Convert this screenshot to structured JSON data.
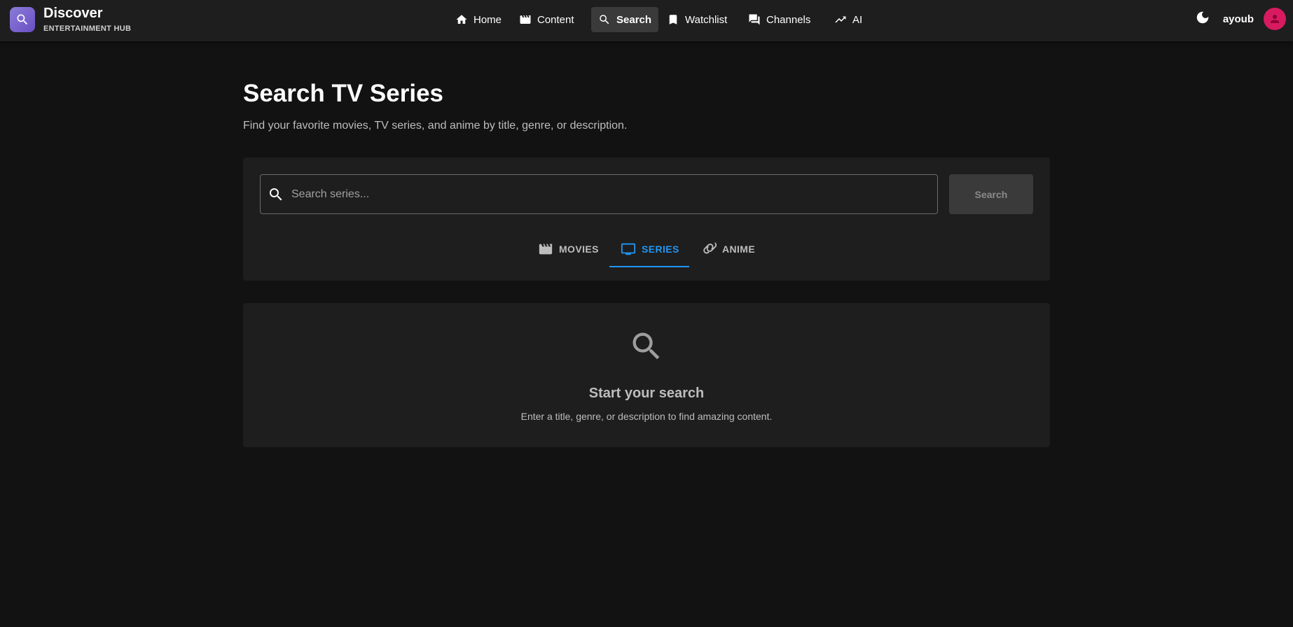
{
  "brand": {
    "title": "Discover",
    "subtitle": "ENTERTAINMENT HUB",
    "logo_icon": "search-icon",
    "logo_color": "#7e67d0"
  },
  "nav": {
    "items": [
      {
        "label": "Home",
        "icon": "home-icon",
        "active": false
      },
      {
        "label": "Content",
        "icon": "movie-icon",
        "active": false
      },
      {
        "label": "Search",
        "icon": "search-icon",
        "active": true
      },
      {
        "label": "Watchlist",
        "icon": "bookmark-icon",
        "active": false
      },
      {
        "label": "Channels",
        "icon": "forum-icon",
        "active": false
      },
      {
        "label": "AI",
        "icon": "trending-up-icon",
        "active": false
      }
    ]
  },
  "user": {
    "name": "ayoub",
    "avatar_color": "#d81b60",
    "theme_icon": "dark-mode-icon"
  },
  "main": {
    "title": "Search TV Series",
    "subtitle": "Find your favorite movies, TV series, and anime by title, genre, or description."
  },
  "search": {
    "placeholder": "Search series...",
    "value": "",
    "button_label": "Search"
  },
  "tabs": [
    {
      "label": "MOVIES",
      "icon": "movie-icon",
      "active": false
    },
    {
      "label": "SERIES",
      "icon": "tv-icon",
      "active": true
    },
    {
      "label": "ANIME",
      "icon": "anime-icon",
      "active": false
    }
  ],
  "empty_state": {
    "icon": "search-icon",
    "title": "Start your search",
    "description": "Enter a title, genre, or description to find amazing content."
  },
  "colors": {
    "accent": "#2196f3",
    "background": "#121212",
    "surface": "#1e1e1e"
  }
}
